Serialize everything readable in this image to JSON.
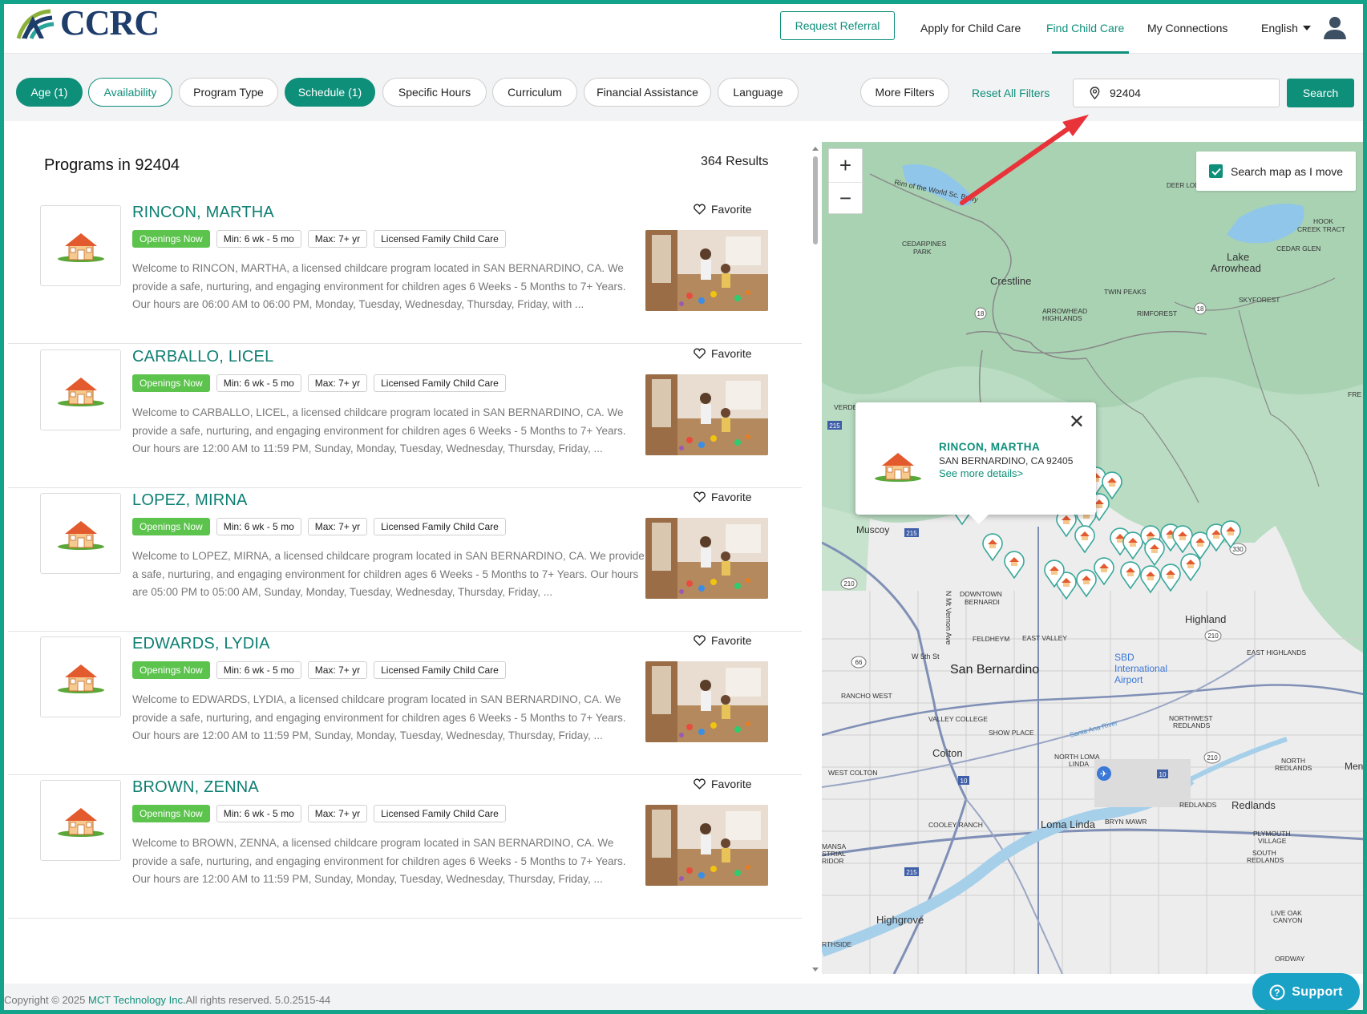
{
  "header": {
    "logo_text": "CCRC",
    "request_referral": "Request Referral",
    "nav": [
      {
        "label": "Apply for Child Care"
      },
      {
        "label": "Find Child Care"
      },
      {
        "label": "My Connections"
      }
    ],
    "language": "English"
  },
  "filters": {
    "chips": [
      {
        "label": "Age (1)"
      },
      {
        "label": "Availability"
      },
      {
        "label": "Program Type"
      },
      {
        "label": "Schedule (1)"
      },
      {
        "label": "Specific Hours"
      },
      {
        "label": "Curriculum"
      },
      {
        "label": "Financial Assistance"
      },
      {
        "label": "Language"
      }
    ],
    "more_filters": "More Filters",
    "reset": "Reset All Filters",
    "search_value": "92404",
    "search_button": "Search"
  },
  "list": {
    "heading": "Programs in 92404",
    "results": "364 Results",
    "favorite_label": "Favorite",
    "tags": {
      "openings": "Openings Now",
      "min": "Min: 6 wk - 5 mo",
      "max": "Max: 7+ yr",
      "type": "Licensed Family Child Care"
    },
    "programs": [
      {
        "name": "RINCON, MARTHA",
        "desc": "Welcome to RINCON, MARTHA, a licensed childcare program located in SAN BERNARDINO, CA. We provide a safe, nurturing, and engaging environment for children ages 6 Weeks - 5 Months to 7+ Years. Our hours are 06:00 AM to 06:00 PM, Monday, Tuesday, Wednesday, Thursday, Friday, with ..."
      },
      {
        "name": "CARBALLO, LICEL",
        "desc": "Welcome to CARBALLO, LICEL, a licensed childcare program located in SAN BERNARDINO, CA. We provide a safe, nurturing, and engaging environment for children ages 6 Weeks - 5 Months to 7+ Years. Our hours are 12:00 AM to 11:59 PM, Sunday, Monday, Tuesday, Wednesday, Thursday, Friday, ..."
      },
      {
        "name": "LOPEZ, MIRNA",
        "desc": "Welcome to LOPEZ, MIRNA, a licensed childcare program located in SAN BERNARDINO, CA. We provide a safe, nurturing, and engaging environment for children ages 6 Weeks - 5 Months to 7+ Years. Our hours are 05:00 PM to 05:00 AM, Sunday, Monday, Tuesday, Wednesday, Thursday, Friday, ..."
      },
      {
        "name": "EDWARDS, LYDIA",
        "desc": "Welcome to EDWARDS, LYDIA, a licensed childcare program located in SAN BERNARDINO, CA. We provide a safe, nurturing, and engaging environment for children ages 6 Weeks - 5 Months to 7+ Years. Our hours are 12:00 AM to 11:59 PM, Sunday, Monday, Tuesday, Wednesday, Thursday, Friday, ..."
      },
      {
        "name": "BROWN, ZENNA",
        "desc": "Welcome to BROWN, ZENNA, a licensed childcare program located in SAN BERNARDINO, CA. We provide a safe, nurturing, and engaging environment for children ages 6 Weeks - 5 Months to 7+ Years. Our hours are 12:00 AM to 11:59 PM, Sunday, Monday, Tuesday, Wednesday, Thursday, Friday, ..."
      }
    ]
  },
  "map": {
    "search_as_move": "Search map as I move",
    "zoom_in": "+",
    "zoom_out": "−",
    "labels": {
      "rim_world": "Rim of the World Sc. Bywy",
      "cedarpines": "CEDARPINES",
      "park": "PARK",
      "crestline": "Crestline",
      "lake": "Lake",
      "arrowhead": "Arrowhead",
      "hook": "HOOK",
      "creek_tract": "CREEK TRACT",
      "cedar_glen": "CEDAR GLEN",
      "deer_lodge": "DEER LODGE P",
      "twin_peaks": "TWIN PEAKS",
      "arrowhead_highlands": "ARROWHEAD",
      "highlands": "HIGHLANDS",
      "rimforest": "RIMFOREST",
      "skyforest": "SKYFOREST",
      "verde": "VERDE",
      "muscoy": "Muscoy",
      "downtown": "DOWNTOWN",
      "bernardino_sm": "BERNARDI",
      "feldheym": "FELDHEYM",
      "east_valley": "EAST VALLEY",
      "san_bernardino": "San Bernardino",
      "sbd_1": "SBD",
      "sbd_2": "International",
      "sbd_3": "Airport",
      "highland": "Highland",
      "east_highlands": "EAST HIGHLANDS",
      "rancho_west": "RANCHO WEST",
      "valley_college": "VALLEY COLLEGE",
      "show_place": "SHOW PLACE",
      "santa_ana": "Santa Ana River",
      "northwest_redlands": "NORTHWEST",
      "redlands_sm": "REDLANDS",
      "colton": "Colton",
      "north_loma": "NORTH LOMA",
      "linda": "LINDA",
      "west_colton": "WEST COLTON",
      "north_redlands": "NORTH",
      "redlands_sm2": "REDLANDS",
      "mentone": "Men",
      "redlands_district": "REDLANDS",
      "redlands": "Redlands",
      "cooley_ranch": "COOLEY RANCH",
      "loma_linda": "Loma Linda",
      "bryn_mawr": "BRYN MAWR",
      "plymouth": "PLYMOUTH",
      "village": "VILLAGE",
      "south_redlands": "SOUTH",
      "south_redlands2": "REDLANDS",
      "highgrove": "Highgrove",
      "live_oak": "LIVE OAK",
      "canyon": "CANYON",
      "ordway": "ORDWAY",
      "rthside": "RTHSIDE",
      "mansa": "MANSA",
      "strial": "STRIAL",
      "ridor": "RIDOR",
      "w5th": "W 5th St",
      "mtvernon": "N Mt Vernon Ave",
      "fre": "FRE",
      "roads": {
        "r215": "215",
        "r18": "18",
        "r210": "210",
        "r10": "10",
        "r66": "66",
        "r330": "330"
      }
    },
    "popup": {
      "name": "RINCON, MARTHA",
      "address": "SAN BERNARDINO, CA 92405",
      "more": "See more details>"
    }
  },
  "footer": {
    "copyright_prefix": "Copyright © 2025 ",
    "company": "MCT Technology Inc.",
    "copyright_suffix": "All rights reserved. 5.0.2515-44"
  },
  "support": "Support",
  "colors": {
    "brand": "#0e8f7a",
    "openings": "#5cc34d",
    "support": "#1aa1c6",
    "frame": "#12a38a",
    "arrow": "#e8333a"
  }
}
